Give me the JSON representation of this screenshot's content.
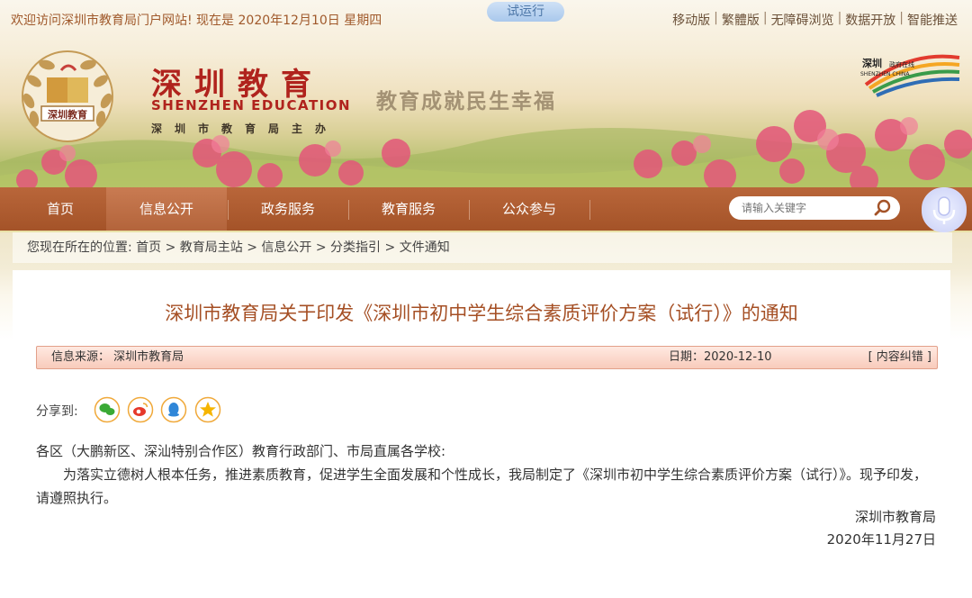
{
  "topbar": {
    "welcome": "欢迎访问深圳市教育局门户网站! 现在是 2020年12月10日 星期四",
    "trial": "试运行",
    "links": [
      "移动版",
      "繁體版",
      "无障碍浏览",
      "数据开放",
      "智能推送"
    ]
  },
  "brand": {
    "title": "深圳教育",
    "english": "SHENZHEN EDUCATION",
    "sub": "深圳市教育局主办",
    "seal_text": "深圳教育",
    "slogan": "教育成就民生幸福",
    "gov_logo_text": "深圳 政府在线 SHENZHEN CHINA"
  },
  "nav": {
    "items": [
      "首页",
      "信息公开",
      "政务服务",
      "教育服务",
      "公众参与"
    ],
    "active_index": 1
  },
  "search": {
    "placeholder": "请输入关键字"
  },
  "breadcrumb": "您现在所在的位置: 首页 > 教育局主站 > 信息公开 > 分类指引 > 文件通知",
  "article": {
    "title": "深圳市教育局关于印发《深圳市初中学生综合素质评价方案（试行）》的通知",
    "source": "信息来源： 深圳市教育局",
    "date": "日期：2020-12-10",
    "error_link": "[ 内容纠错 ]",
    "share_label": "分享到:",
    "share_icons": [
      "wechat-icon",
      "weibo-icon",
      "qq-icon",
      "qzone-icon"
    ],
    "paragraph1": "各区（大鹏新区、深汕特别合作区）教育行政部门、市局直属各学校:",
    "paragraph2": "为落实立德树人根本任务，推进素质教育，促进学生全面发展和个性成长，我局制定了《深圳市初中学生综合素质评价方案（试行）》。现予印发，请遵照执行。",
    "signature": "深圳市教育局",
    "sign_date": "2020年11月27日"
  },
  "colors": {
    "nav_bg": "#a85a2f",
    "title_color": "#a54f24",
    "brand_red": "#b0231d"
  }
}
